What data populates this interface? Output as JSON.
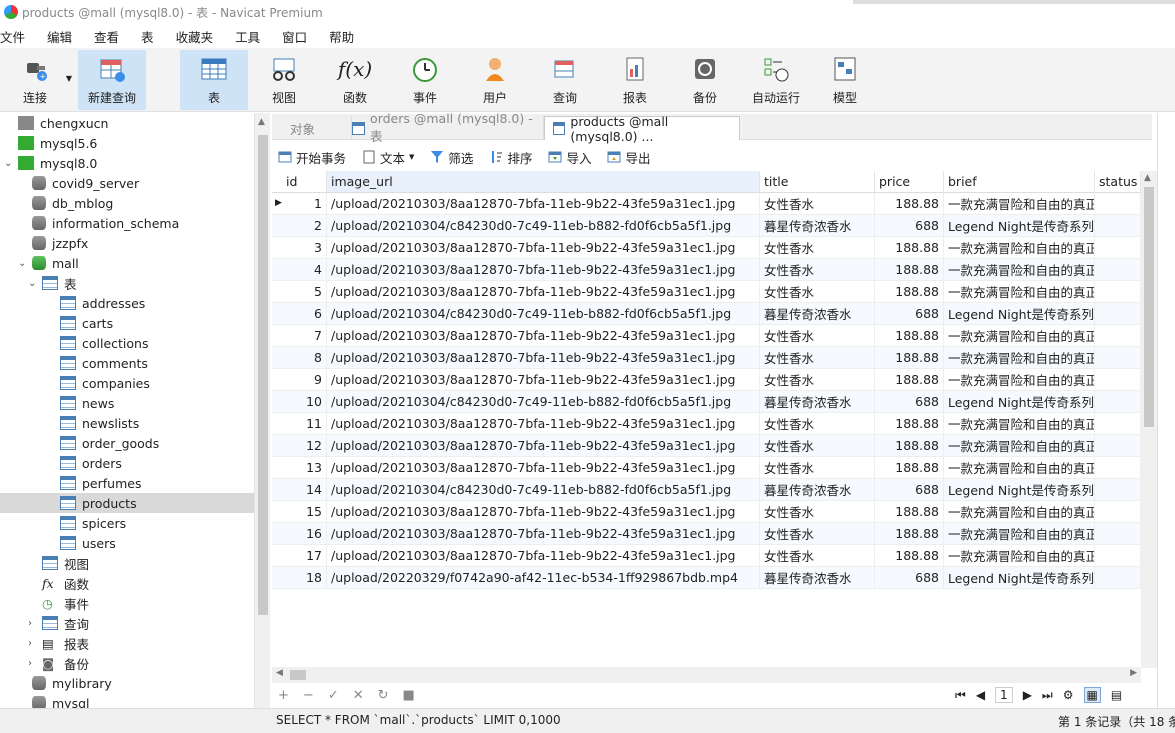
{
  "window": {
    "title": "products @mall (mysql8.0) - 表 - Navicat Premium"
  },
  "menu": [
    "文件",
    "编辑",
    "查看",
    "表",
    "收藏夹",
    "工具",
    "窗口",
    "帮助"
  ],
  "toolbar": {
    "connect": "连接",
    "new_query": "新建查询",
    "table": "表",
    "view": "视图",
    "function": "函数",
    "event": "事件",
    "user": "用户",
    "query": "查询",
    "report": "报表",
    "backup": "备份",
    "auto_run": "自动运行",
    "model": "模型"
  },
  "sidebar": {
    "items": [
      {
        "label": "chengxucn",
        "level": 0,
        "type": "conn-gray"
      },
      {
        "label": "mysql5.6",
        "level": 0,
        "type": "conn"
      },
      {
        "label": "mysql8.0",
        "level": 0,
        "type": "conn",
        "expanded": true
      },
      {
        "label": "covid9_server",
        "level": 1,
        "type": "db"
      },
      {
        "label": "db_mblog",
        "level": 1,
        "type": "db"
      },
      {
        "label": "information_schema",
        "level": 1,
        "type": "db"
      },
      {
        "label": "jzzpfx",
        "level": 1,
        "type": "db"
      },
      {
        "label": "mall",
        "level": 1,
        "type": "db-green",
        "expanded": true
      },
      {
        "label": "表",
        "level": 2,
        "type": "table",
        "expanded": true
      },
      {
        "label": "addresses",
        "level": 3,
        "type": "table"
      },
      {
        "label": "carts",
        "level": 3,
        "type": "table"
      },
      {
        "label": "collections",
        "level": 3,
        "type": "table"
      },
      {
        "label": "comments",
        "level": 3,
        "type": "table"
      },
      {
        "label": "companies",
        "level": 3,
        "type": "table"
      },
      {
        "label": "news",
        "level": 3,
        "type": "table"
      },
      {
        "label": "newslists",
        "level": 3,
        "type": "table"
      },
      {
        "label": "order_goods",
        "level": 3,
        "type": "table"
      },
      {
        "label": "orders",
        "level": 3,
        "type": "table"
      },
      {
        "label": "perfumes",
        "level": 3,
        "type": "table"
      },
      {
        "label": "products",
        "level": 3,
        "type": "table",
        "selected": true
      },
      {
        "label": "spicers",
        "level": 3,
        "type": "table"
      },
      {
        "label": "users",
        "level": 3,
        "type": "table"
      },
      {
        "label": "视图",
        "level": 2,
        "type": "view"
      },
      {
        "label": "函数",
        "level": 2,
        "type": "fx"
      },
      {
        "label": "事件",
        "level": 2,
        "type": "event"
      },
      {
        "label": "查询",
        "level": 2,
        "type": "query"
      },
      {
        "label": "报表",
        "level": 2,
        "type": "report"
      },
      {
        "label": "备份",
        "level": 2,
        "type": "backup"
      },
      {
        "label": "mylibrary",
        "level": 1,
        "type": "db"
      },
      {
        "label": "mysql",
        "level": 1,
        "type": "db"
      }
    ]
  },
  "tabs": [
    {
      "label": "对象",
      "active": false
    },
    {
      "label": "orders @mall (mysql8.0) - 表",
      "active": false
    },
    {
      "label": "products @mall (mysql8.0) ...",
      "active": true
    }
  ],
  "actions": {
    "begin_tx": "开始事务",
    "text": "文本",
    "filter": "筛选",
    "sort": "排序",
    "import": "导入",
    "export": "导出"
  },
  "grid": {
    "columns": [
      "id",
      "image_url",
      "title",
      "price",
      "brief",
      "status"
    ],
    "rows": [
      [
        "1",
        "/upload/20210303/8aa12870-7bfa-11eb-9b22-43fe59a31ec1.jpg",
        "女性香水",
        "188.88",
        "一款充满冒险和自由的真正"
      ],
      [
        "2",
        "/upload/20210304/c84230d0-7c49-11eb-b882-fd0f6cb5a5f1.jpg",
        "暮星传奇浓香水",
        "688",
        "Legend Night是传奇系列香"
      ],
      [
        "3",
        "/upload/20210303/8aa12870-7bfa-11eb-9b22-43fe59a31ec1.jpg",
        "女性香水",
        "188.88",
        "一款充满冒险和自由的真正"
      ],
      [
        "4",
        "/upload/20210303/8aa12870-7bfa-11eb-9b22-43fe59a31ec1.jpg",
        "女性香水",
        "188.88",
        "一款充满冒险和自由的真正"
      ],
      [
        "5",
        "/upload/20210303/8aa12870-7bfa-11eb-9b22-43fe59a31ec1.jpg",
        "女性香水",
        "188.88",
        "一款充满冒险和自由的真正"
      ],
      [
        "6",
        "/upload/20210304/c84230d0-7c49-11eb-b882-fd0f6cb5a5f1.jpg",
        "暮星传奇浓香水",
        "688",
        "Legend Night是传奇系列香"
      ],
      [
        "7",
        "/upload/20210303/8aa12870-7bfa-11eb-9b22-43fe59a31ec1.jpg",
        "女性香水",
        "188.88",
        "一款充满冒险和自由的真正"
      ],
      [
        "8",
        "/upload/20210303/8aa12870-7bfa-11eb-9b22-43fe59a31ec1.jpg",
        "女性香水",
        "188.88",
        "一款充满冒险和自由的真正"
      ],
      [
        "9",
        "/upload/20210303/8aa12870-7bfa-11eb-9b22-43fe59a31ec1.jpg",
        "女性香水",
        "188.88",
        "一款充满冒险和自由的真正"
      ],
      [
        "10",
        "/upload/20210304/c84230d0-7c49-11eb-b882-fd0f6cb5a5f1.jpg",
        "暮星传奇浓香水",
        "688",
        "Legend Night是传奇系列香"
      ],
      [
        "11",
        "/upload/20210303/8aa12870-7bfa-11eb-9b22-43fe59a31ec1.jpg",
        "女性香水",
        "188.88",
        "一款充满冒险和自由的真正"
      ],
      [
        "12",
        "/upload/20210303/8aa12870-7bfa-11eb-9b22-43fe59a31ec1.jpg",
        "女性香水",
        "188.88",
        "一款充满冒险和自由的真正"
      ],
      [
        "13",
        "/upload/20210303/8aa12870-7bfa-11eb-9b22-43fe59a31ec1.jpg",
        "女性香水",
        "188.88",
        "一款充满冒险和自由的真正"
      ],
      [
        "14",
        "/upload/20210304/c84230d0-7c49-11eb-b882-fd0f6cb5a5f1.jpg",
        "暮星传奇浓香水",
        "688",
        "Legend Night是传奇系列香"
      ],
      [
        "15",
        "/upload/20210303/8aa12870-7bfa-11eb-9b22-43fe59a31ec1.jpg",
        "女性香水",
        "188.88",
        "一款充满冒险和自由的真正"
      ],
      [
        "16",
        "/upload/20210303/8aa12870-7bfa-11eb-9b22-43fe59a31ec1.jpg",
        "女性香水",
        "188.88",
        "一款充满冒险和自由的真正"
      ],
      [
        "17",
        "/upload/20210303/8aa12870-7bfa-11eb-9b22-43fe59a31ec1.jpg",
        "女性香水",
        "188.88",
        "一款充满冒险和自由的真正"
      ],
      [
        "18",
        "/upload/20220329/f0742a90-af42-11ec-b534-1ff929867bdb.mp4",
        "暮星传奇浓香水",
        "688",
        "Legend Night是传奇系列香"
      ]
    ]
  },
  "pager": {
    "page": "1"
  },
  "status": {
    "sql": "SELECT * FROM `mall`.`products` LIMIT 0,1000",
    "records": "第 1 条记录（共 18 条"
  },
  "colors": {
    "accent": "#cfe3f6",
    "selected_row": "#d9d9d9",
    "alt_row": "#f3f8fd"
  }
}
